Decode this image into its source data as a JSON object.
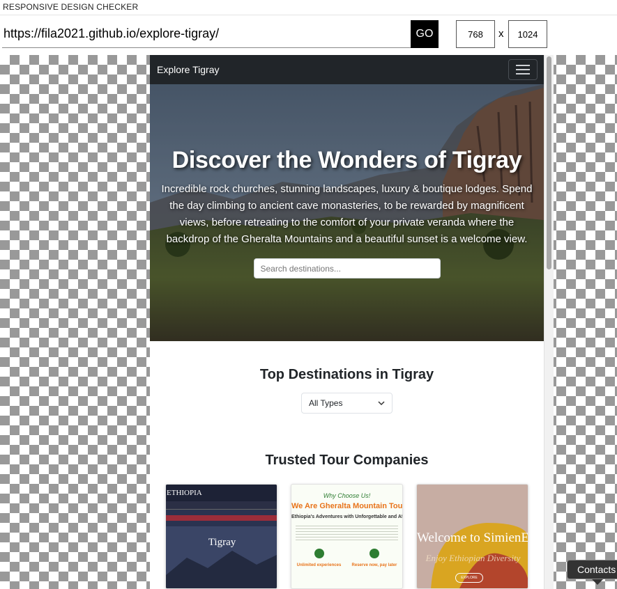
{
  "app": {
    "title": "RESPONSIVE DESIGN CHECKER"
  },
  "toolbar": {
    "url": "https://fila2021.github.io/explore-tigray/",
    "go_label": "GO",
    "width": "768",
    "height": "1024",
    "x_label": "x"
  },
  "site": {
    "brand": "Explore Tigray",
    "hero_title": "Discover the Wonders of Tigray",
    "hero_subtitle": "Incredible rock churches, stunning landscapes, luxury & boutique lodges. Spend the day climbing to ancient cave monasteries, to be rewarded by magnificent views, before retreating to the comfort of your private veranda where the backdrop of the Gheralta Mountains and a beautiful sunset is a welcome view.",
    "search_placeholder": "Search destinations...",
    "destinations_title": "Top Destinations in Tigray",
    "filter_value": "All Types",
    "companies_title": "Trusted Tour Companies",
    "cards": [
      {
        "logo": "ETHIOPIA",
        "city": "Tigray"
      },
      {
        "tagline": "Why Choose Us!",
        "heading": "We Are Gheralta Mountain Tours",
        "subheading": "Ethiopia's Adventures with Unforgettable and Affordable",
        "feature1": "Unlimited experiences",
        "feature2": "Reserve now, pay later"
      },
      {
        "heading": "Welcome to SimienEcoTours",
        "script": "Enjoy Ethiopian Diversity",
        "button": "EXPLORE"
      }
    ]
  },
  "tooltip": {
    "text": "Contacts"
  },
  "colors": {
    "navbar": "#212529",
    "checker": "#999999",
    "accent_orange": "#e8731a",
    "accent_green": "#2e7d32"
  }
}
